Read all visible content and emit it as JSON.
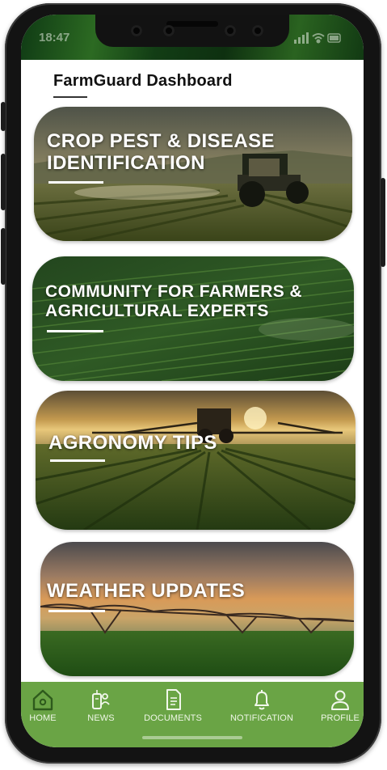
{
  "status_bar": {
    "time": "18:47"
  },
  "header": {
    "title": "FarmGuard Dashboard"
  },
  "cards": [
    {
      "title": "CROP PEST & DISEASE IDENTIFICATION"
    },
    {
      "title": "COMMUNITY FOR FARMERS & AGRICULTURAL EXPERTS"
    },
    {
      "title": "AGRONOMY TIPS"
    },
    {
      "title": "WEATHER UPDATES"
    }
  ],
  "tab_bar": {
    "items": [
      {
        "label": "HOME",
        "icon": "home-icon",
        "active": true
      },
      {
        "label": "NEWS",
        "icon": "news-icon",
        "active": false
      },
      {
        "label": "DOCUMENTS",
        "icon": "document-icon",
        "active": false
      },
      {
        "label": "NOTIFICATION",
        "icon": "bell-icon",
        "active": false
      },
      {
        "label": "PROFILE",
        "icon": "user-icon",
        "active": false
      }
    ]
  },
  "colors": {
    "tab_bar_bg": "#6aa445",
    "tab_icon": "#f1f7ec",
    "tab_active_icon": "#2e5a1c",
    "card_text": "#ffffff"
  }
}
